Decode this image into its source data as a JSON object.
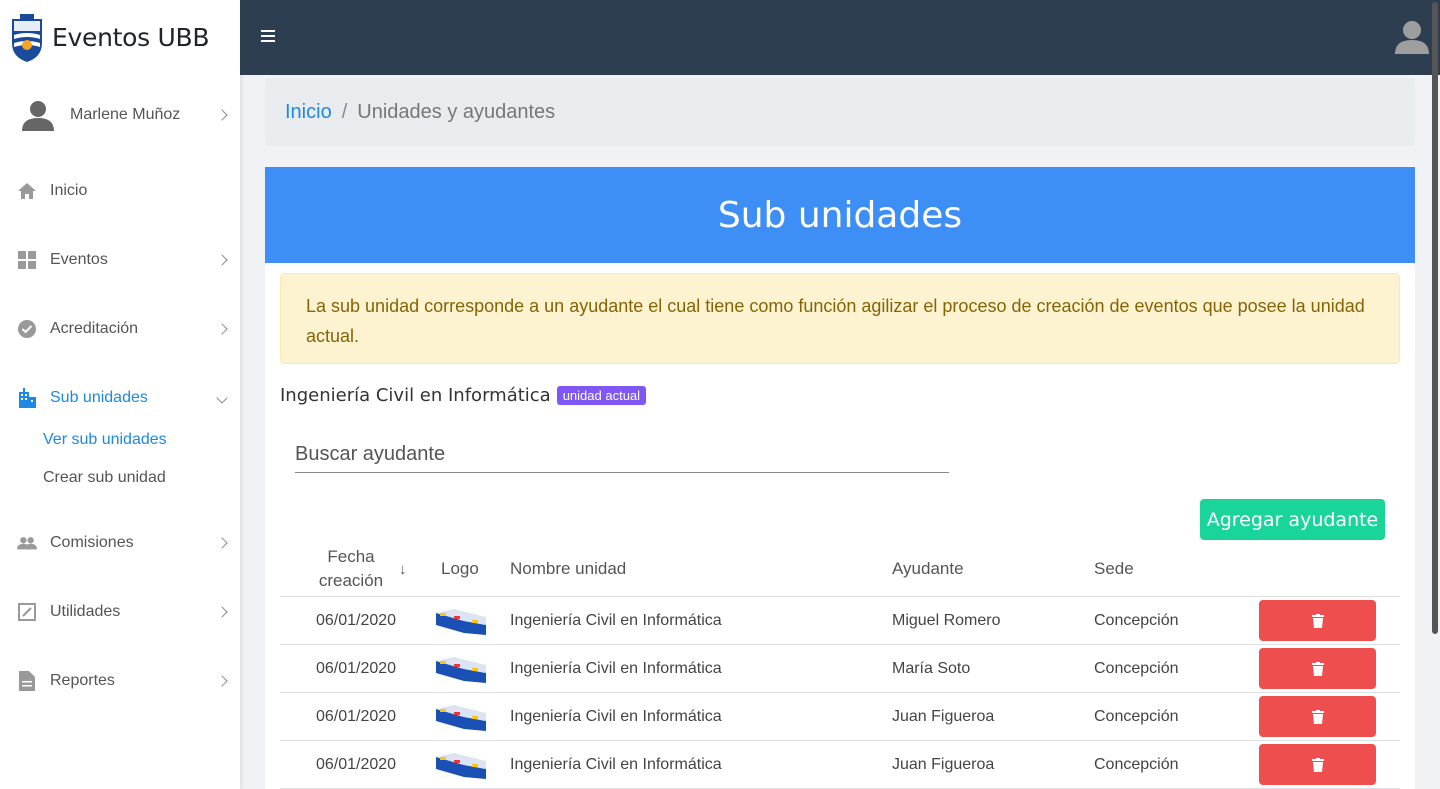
{
  "brand": {
    "name": "Eventos UBB"
  },
  "user": {
    "name": "Marlene Muñoz"
  },
  "nav": {
    "inicio": "Inicio",
    "eventos": "Eventos",
    "acreditacion": "Acreditación",
    "sub_unidades": "Sub unidades",
    "ver_sub_unidades": "Ver sub unidades",
    "crear_sub_unidad": "Crear sub unidad",
    "comisiones": "Comisiones",
    "utilidades": "Utilidades",
    "reportes": "Reportes"
  },
  "breadcrumb": {
    "home": "Inicio",
    "separator": "/",
    "current": "Unidades y ayudantes"
  },
  "card": {
    "title": "Sub unidades",
    "alert": "La sub unidad corresponde a un ayudante el cual tiene como función agilizar el proceso de creación de eventos que posee la unidad actual.",
    "unit_name": "Ingeniería Civil en Informática",
    "unit_badge": "unidad actual",
    "search_placeholder": "Buscar ayudante",
    "add_button": "Agregar ayudante"
  },
  "table": {
    "headers": {
      "fecha_line1": "Fecha",
      "fecha_line2": "creación",
      "sort_arrow": "↓",
      "logo": "Logo",
      "nombre": "Nombre unidad",
      "ayudante": "Ayudante",
      "sede": "Sede"
    },
    "rows": [
      {
        "fecha": "06/01/2020",
        "nombre": "Ingeniería Civil en Informática",
        "ayudante": "Miguel Romero",
        "sede": "Concepción"
      },
      {
        "fecha": "06/01/2020",
        "nombre": "Ingeniería Civil en Informática",
        "ayudante": "María Soto",
        "sede": "Concepción"
      },
      {
        "fecha": "06/01/2020",
        "nombre": "Ingeniería Civil en Informática",
        "ayudante": "Juan Figueroa",
        "sede": "Concepción"
      },
      {
        "fecha": "06/01/2020",
        "nombre": "Ingeniería Civil en Informática",
        "ayudante": "Juan Figueroa",
        "sede": "Concepción"
      }
    ]
  },
  "colors": {
    "topbar": "#2c3e50",
    "card_header": "#3d8ef5",
    "add_button": "#1ad59a",
    "delete_button": "#ef4e4e",
    "badge": "#7e57f5",
    "active_link": "#1e88e5"
  }
}
